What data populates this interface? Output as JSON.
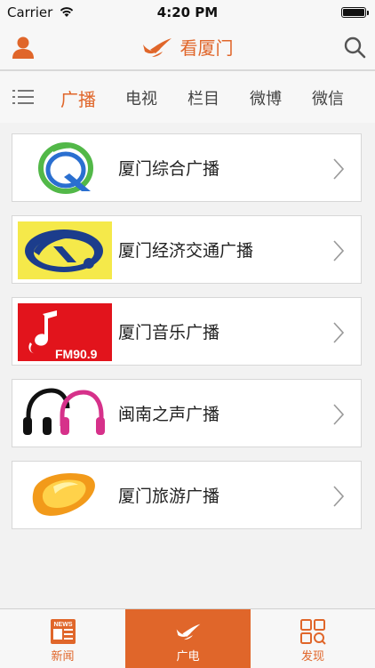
{
  "status_bar": {
    "carrier": "Carrier",
    "time": "4:20 PM"
  },
  "header": {
    "brand_name": "看厦门",
    "icons": {
      "left": "user-icon",
      "right": "search-icon",
      "logo": "swallow-logo-icon"
    }
  },
  "category_tabs": {
    "menu_icon": "list-menu-icon",
    "items": [
      "广播",
      "电视",
      "栏目",
      "微博",
      "微信"
    ],
    "active_index": 0
  },
  "stations": [
    {
      "name": "厦门综合广播",
      "logo": "xiamen-comprehensive-logo"
    },
    {
      "name": "厦门经济交通广播",
      "logo": "xiamen-traffic-logo"
    },
    {
      "name": "厦门音乐广播",
      "logo": "xiamen-music-logo",
      "logo_text": "FM90.9"
    },
    {
      "name": "闽南之声广播",
      "logo": "minnan-headphones-logo"
    },
    {
      "name": "厦门旅游广播",
      "logo": "xiamen-travel-logo"
    }
  ],
  "tab_bar": {
    "items": [
      {
        "label": "新闻",
        "icon": "news-icon",
        "icon_text": "NEWS"
      },
      {
        "label": "广电",
        "icon": "swallow-logo-icon"
      },
      {
        "label": "发现",
        "icon": "discover-grid-icon"
      }
    ],
    "active_index": 1
  },
  "colors": {
    "accent": "#e0662a",
    "background": "#f2f2f2",
    "card": "#ffffff"
  }
}
